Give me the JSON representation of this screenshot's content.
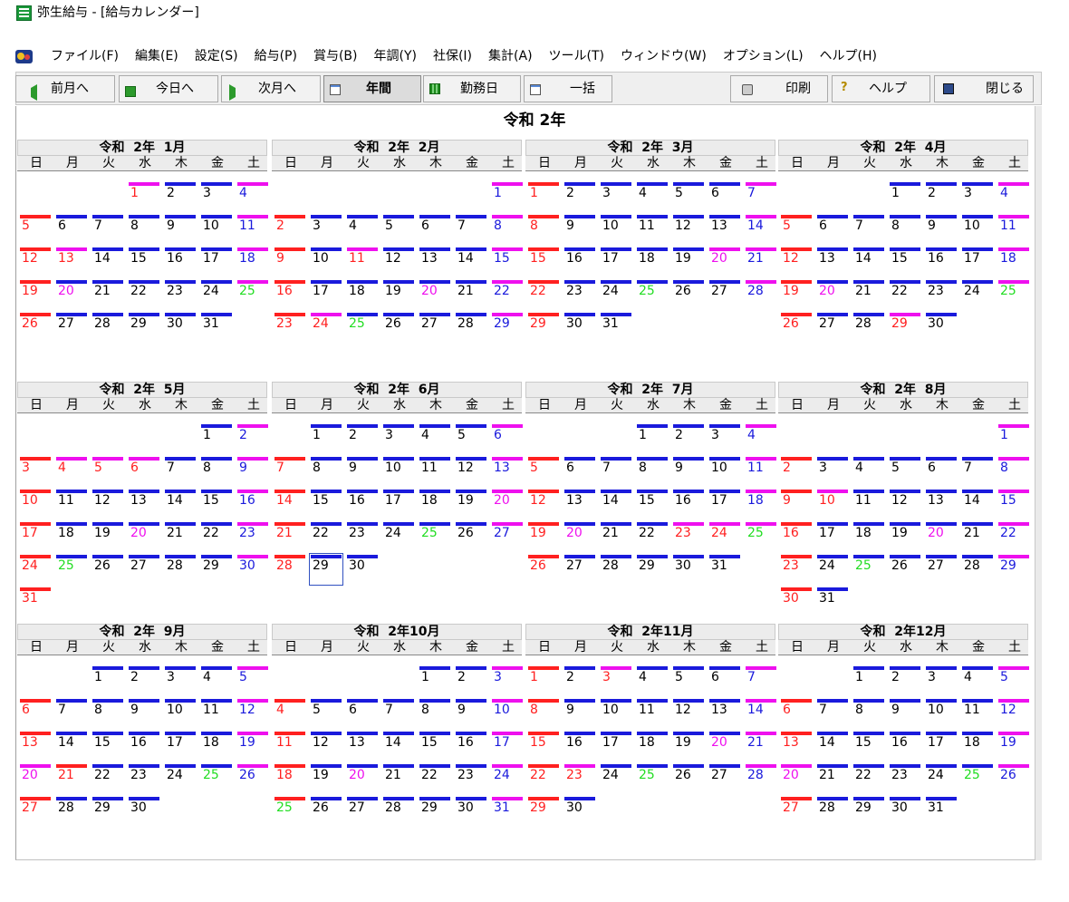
{
  "window": {
    "title": "弥生給与 - [給与カレンダー]",
    "icon": "yayoi-app-icon"
  },
  "menu": {
    "items": [
      "ファイル(F)",
      "編集(E)",
      "設定(S)",
      "給与(P)",
      "賞与(B)",
      "年調(Y)",
      "社保(I)",
      "集計(A)",
      "ツール(T)",
      "ウィンドウ(W)",
      "オプション(L)",
      "ヘルプ(H)"
    ]
  },
  "toolbar": {
    "prev_month": "前月へ",
    "today": "今日へ",
    "next_month": "次月へ",
    "annual": "年間",
    "workday": "勤務日",
    "bulk": "一括",
    "print": "印刷",
    "help": "ヘルプ",
    "close": "閉じる"
  },
  "calendar": {
    "year_title": "令和 2年",
    "weekdays": [
      "日",
      "月",
      "火",
      "水",
      "木",
      "金",
      "土"
    ],
    "colors": {
      "red": "#ff2020",
      "blue": "#1a1adc",
      "magenta": "#ee10ee",
      "green": "#22dd22",
      "black": "#000000"
    },
    "selected_day": {
      "month": 6,
      "day": 29
    },
    "months": [
      {
        "title": "令和  2年  1月",
        "start": 3,
        "days": 31,
        "bars": {
          "1": "magenta",
          "2": "blue",
          "3": "blue",
          "4": "magenta",
          "5": "red",
          "6": "blue",
          "7": "blue",
          "8": "blue",
          "9": "blue",
          "10": "blue",
          "11": "magenta",
          "12": "red",
          "13": "magenta",
          "14": "blue",
          "15": "blue",
          "16": "blue",
          "17": "blue",
          "18": "magenta",
          "19": "red",
          "20": "blue",
          "21": "blue",
          "22": "blue",
          "23": "blue",
          "24": "blue",
          "25": "magenta",
          "26": "red",
          "27": "blue",
          "28": "blue",
          "29": "blue",
          "30": "blue",
          "31": "blue"
        },
        "text": {
          "1": "red",
          "4": "blue",
          "5": "red",
          "11": "blue",
          "12": "red",
          "13": "red",
          "18": "blue",
          "19": "red",
          "20": "magenta",
          "25": "green",
          "26": "red"
        }
      },
      {
        "title": "令和  2年  2月",
        "start": 6,
        "days": 29,
        "bars": {
          "1": "magenta",
          "2": "red",
          "3": "blue",
          "4": "blue",
          "5": "blue",
          "6": "blue",
          "7": "blue",
          "8": "magenta",
          "9": "red",
          "10": "blue",
          "11": "magenta",
          "12": "blue",
          "13": "blue",
          "14": "blue",
          "15": "magenta",
          "16": "red",
          "17": "blue",
          "18": "blue",
          "19": "blue",
          "20": "blue",
          "21": "blue",
          "22": "magenta",
          "23": "red",
          "24": "magenta",
          "25": "blue",
          "26": "blue",
          "27": "blue",
          "28": "blue",
          "29": "magenta"
        },
        "text": {
          "1": "blue",
          "2": "red",
          "8": "blue",
          "9": "red",
          "11": "red",
          "15": "blue",
          "16": "red",
          "20": "magenta",
          "22": "blue",
          "23": "red",
          "24": "red",
          "25": "green",
          "29": "blue"
        }
      },
      {
        "title": "令和  2年  3月",
        "start": 0,
        "days": 31,
        "bars": {
          "1": "red",
          "2": "blue",
          "3": "blue",
          "4": "blue",
          "5": "blue",
          "6": "blue",
          "7": "magenta",
          "8": "red",
          "9": "blue",
          "10": "blue",
          "11": "blue",
          "12": "blue",
          "13": "blue",
          "14": "magenta",
          "15": "red",
          "16": "blue",
          "17": "blue",
          "18": "blue",
          "19": "blue",
          "20": "magenta",
          "21": "magenta",
          "22": "red",
          "23": "blue",
          "24": "blue",
          "25": "blue",
          "26": "blue",
          "27": "blue",
          "28": "magenta",
          "29": "red",
          "30": "blue",
          "31": "blue"
        },
        "text": {
          "1": "red",
          "7": "blue",
          "8": "red",
          "14": "blue",
          "15": "red",
          "20": "magenta",
          "21": "blue",
          "22": "red",
          "25": "green",
          "28": "blue",
          "29": "red"
        }
      },
      {
        "title": "令和  2年  4月",
        "start": 3,
        "days": 30,
        "bars": {
          "1": "blue",
          "2": "blue",
          "3": "blue",
          "4": "magenta",
          "5": "red",
          "6": "blue",
          "7": "blue",
          "8": "blue",
          "9": "blue",
          "10": "blue",
          "11": "magenta",
          "12": "red",
          "13": "blue",
          "14": "blue",
          "15": "blue",
          "16": "blue",
          "17": "blue",
          "18": "magenta",
          "19": "red",
          "20": "blue",
          "21": "blue",
          "22": "blue",
          "23": "blue",
          "24": "blue",
          "25": "magenta",
          "26": "red",
          "27": "blue",
          "28": "blue",
          "29": "magenta",
          "30": "blue"
        },
        "text": {
          "4": "blue",
          "5": "red",
          "11": "blue",
          "12": "red",
          "18": "blue",
          "19": "red",
          "20": "magenta",
          "25": "green",
          "26": "red",
          "29": "red"
        }
      },
      {
        "title": "令和  2年  5月",
        "start": 5,
        "days": 31,
        "bars": {
          "1": "blue",
          "2": "magenta",
          "3": "red",
          "4": "magenta",
          "5": "magenta",
          "6": "magenta",
          "7": "blue",
          "8": "blue",
          "9": "magenta",
          "10": "red",
          "11": "blue",
          "12": "blue",
          "13": "blue",
          "14": "blue",
          "15": "blue",
          "16": "magenta",
          "17": "red",
          "18": "blue",
          "19": "blue",
          "20": "blue",
          "21": "blue",
          "22": "blue",
          "23": "magenta",
          "24": "red",
          "25": "blue",
          "26": "blue",
          "27": "blue",
          "28": "blue",
          "29": "blue",
          "30": "magenta",
          "31": "red"
        },
        "text": {
          "2": "blue",
          "3": "red",
          "4": "red",
          "5": "red",
          "6": "red",
          "9": "blue",
          "10": "red",
          "16": "blue",
          "17": "red",
          "20": "magenta",
          "23": "blue",
          "24": "red",
          "25": "green",
          "30": "blue",
          "31": "red"
        }
      },
      {
        "title": "令和  2年  6月",
        "start": 1,
        "days": 30,
        "bars": {
          "1": "blue",
          "2": "blue",
          "3": "blue",
          "4": "blue",
          "5": "blue",
          "6": "magenta",
          "7": "red",
          "8": "blue",
          "9": "blue",
          "10": "blue",
          "11": "blue",
          "12": "blue",
          "13": "magenta",
          "14": "red",
          "15": "blue",
          "16": "blue",
          "17": "blue",
          "18": "blue",
          "19": "blue",
          "20": "magenta",
          "21": "red",
          "22": "blue",
          "23": "blue",
          "24": "blue",
          "25": "blue",
          "26": "blue",
          "27": "magenta",
          "28": "red",
          "29": "blue",
          "30": "blue"
        },
        "text": {
          "6": "blue",
          "7": "red",
          "13": "blue",
          "14": "red",
          "20": "magenta",
          "21": "red",
          "25": "green",
          "27": "blue",
          "28": "red"
        }
      },
      {
        "title": "令和  2年  7月",
        "start": 3,
        "days": 31,
        "bars": {
          "1": "blue",
          "2": "blue",
          "3": "blue",
          "4": "magenta",
          "5": "red",
          "6": "blue",
          "7": "blue",
          "8": "blue",
          "9": "blue",
          "10": "blue",
          "11": "magenta",
          "12": "red",
          "13": "blue",
          "14": "blue",
          "15": "blue",
          "16": "blue",
          "17": "blue",
          "18": "magenta",
          "19": "red",
          "20": "blue",
          "21": "blue",
          "22": "blue",
          "23": "magenta",
          "24": "magenta",
          "25": "magenta",
          "26": "red",
          "27": "blue",
          "28": "blue",
          "29": "blue",
          "30": "blue",
          "31": "blue"
        },
        "text": {
          "4": "blue",
          "5": "red",
          "11": "blue",
          "12": "red",
          "18": "blue",
          "19": "red",
          "20": "magenta",
          "23": "red",
          "24": "red",
          "25": "green",
          "26": "red"
        }
      },
      {
        "title": "令和  2年  8月",
        "start": 6,
        "days": 31,
        "bars": {
          "1": "magenta",
          "2": "red",
          "3": "blue",
          "4": "blue",
          "5": "blue",
          "6": "blue",
          "7": "blue",
          "8": "magenta",
          "9": "red",
          "10": "magenta",
          "11": "blue",
          "12": "blue",
          "13": "blue",
          "14": "blue",
          "15": "magenta",
          "16": "red",
          "17": "blue",
          "18": "blue",
          "19": "blue",
          "20": "blue",
          "21": "blue",
          "22": "magenta",
          "23": "red",
          "24": "blue",
          "25": "blue",
          "26": "blue",
          "27": "blue",
          "28": "blue",
          "29": "magenta",
          "30": "red",
          "31": "blue"
        },
        "text": {
          "1": "blue",
          "2": "red",
          "8": "blue",
          "9": "red",
          "10": "red",
          "15": "blue",
          "16": "red",
          "20": "magenta",
          "22": "blue",
          "23": "red",
          "25": "green",
          "29": "blue",
          "30": "red"
        }
      },
      {
        "title": "令和  2年  9月",
        "start": 2,
        "days": 30,
        "bars": {
          "1": "blue",
          "2": "blue",
          "3": "blue",
          "4": "blue",
          "5": "magenta",
          "6": "red",
          "7": "blue",
          "8": "blue",
          "9": "blue",
          "10": "blue",
          "11": "blue",
          "12": "magenta",
          "13": "red",
          "14": "blue",
          "15": "blue",
          "16": "blue",
          "17": "blue",
          "18": "blue",
          "19": "magenta",
          "20": "magenta",
          "21": "red",
          "22": "blue",
          "23": "blue",
          "24": "blue",
          "25": "blue",
          "26": "magenta",
          "27": "red",
          "28": "blue",
          "29": "blue",
          "30": "blue"
        },
        "text": {
          "5": "blue",
          "6": "red",
          "12": "blue",
          "13": "red",
          "19": "blue",
          "20": "magenta",
          "21": "red",
          "25": "green",
          "26": "blue",
          "27": "red"
        }
      },
      {
        "title": "令和  2年10月",
        "start": 4,
        "days": 31,
        "bars": {
          "1": "blue",
          "2": "blue",
          "3": "magenta",
          "4": "red",
          "5": "blue",
          "6": "blue",
          "7": "blue",
          "8": "blue",
          "9": "blue",
          "10": "magenta",
          "11": "red",
          "12": "blue",
          "13": "blue",
          "14": "blue",
          "15": "blue",
          "16": "blue",
          "17": "magenta",
          "18": "red",
          "19": "blue",
          "20": "blue",
          "21": "blue",
          "22": "blue",
          "23": "blue",
          "24": "magenta",
          "25": "red",
          "26": "blue",
          "27": "blue",
          "28": "blue",
          "29": "blue",
          "30": "blue",
          "31": "magenta"
        },
        "text": {
          "3": "blue",
          "4": "red",
          "10": "blue",
          "11": "red",
          "17": "blue",
          "18": "red",
          "20": "magenta",
          "24": "blue",
          "25": "green",
          "31": "blue"
        }
      },
      {
        "title": "令和  2年11月",
        "start": 0,
        "days": 30,
        "bars": {
          "1": "red",
          "2": "blue",
          "3": "magenta",
          "4": "blue",
          "5": "blue",
          "6": "blue",
          "7": "magenta",
          "8": "red",
          "9": "blue",
          "10": "blue",
          "11": "blue",
          "12": "blue",
          "13": "blue",
          "14": "magenta",
          "15": "red",
          "16": "blue",
          "17": "blue",
          "18": "blue",
          "19": "blue",
          "20": "blue",
          "21": "magenta",
          "22": "red",
          "23": "magenta",
          "24": "blue",
          "25": "blue",
          "26": "blue",
          "27": "blue",
          "28": "magenta",
          "29": "red",
          "30": "blue"
        },
        "text": {
          "1": "red",
          "3": "red",
          "7": "blue",
          "8": "red",
          "14": "blue",
          "15": "red",
          "20": "magenta",
          "21": "blue",
          "22": "red",
          "23": "red",
          "25": "green",
          "28": "blue",
          "29": "red"
        }
      },
      {
        "title": "令和  2年12月",
        "start": 2,
        "days": 31,
        "bars": {
          "1": "blue",
          "2": "blue",
          "3": "blue",
          "4": "blue",
          "5": "magenta",
          "6": "red",
          "7": "blue",
          "8": "blue",
          "9": "blue",
          "10": "blue",
          "11": "blue",
          "12": "magenta",
          "13": "red",
          "14": "blue",
          "15": "blue",
          "16": "blue",
          "17": "blue",
          "18": "blue",
          "19": "magenta",
          "20": "magenta",
          "21": "blue",
          "22": "blue",
          "23": "blue",
          "24": "blue",
          "25": "blue",
          "26": "magenta",
          "27": "red",
          "28": "blue",
          "29": "blue",
          "30": "blue",
          "31": "blue"
        },
        "text": {
          "5": "blue",
          "6": "red",
          "12": "blue",
          "13": "red",
          "19": "blue",
          "20": "magenta",
          "25": "green",
          "26": "blue",
          "27": "red"
        }
      }
    ]
  }
}
